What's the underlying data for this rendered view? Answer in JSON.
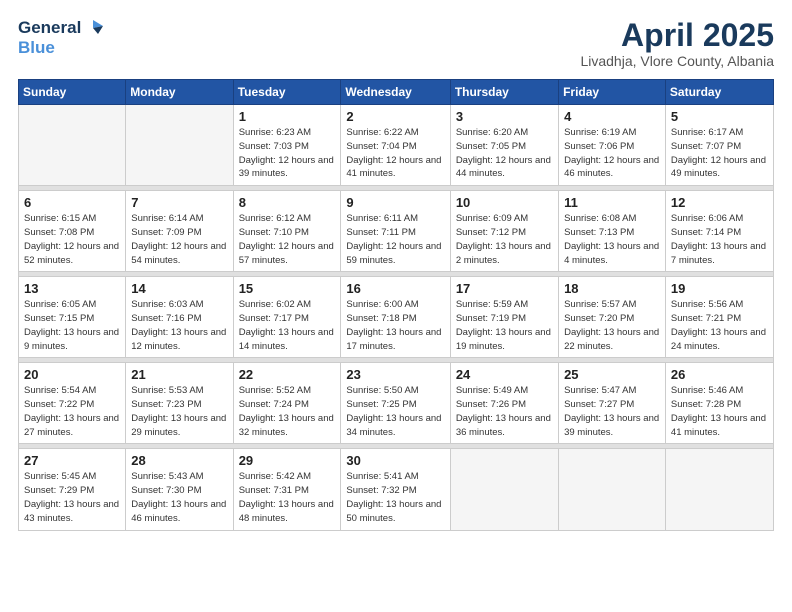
{
  "header": {
    "logo_line1": "General",
    "logo_line2": "Blue",
    "month": "April 2025",
    "location": "Livadhja, Vlore County, Albania"
  },
  "weekdays": [
    "Sunday",
    "Monday",
    "Tuesday",
    "Wednesday",
    "Thursday",
    "Friday",
    "Saturday"
  ],
  "weeks": [
    [
      {
        "day": "",
        "info": ""
      },
      {
        "day": "",
        "info": ""
      },
      {
        "day": "1",
        "info": "Sunrise: 6:23 AM\nSunset: 7:03 PM\nDaylight: 12 hours and 39 minutes."
      },
      {
        "day": "2",
        "info": "Sunrise: 6:22 AM\nSunset: 7:04 PM\nDaylight: 12 hours and 41 minutes."
      },
      {
        "day": "3",
        "info": "Sunrise: 6:20 AM\nSunset: 7:05 PM\nDaylight: 12 hours and 44 minutes."
      },
      {
        "day": "4",
        "info": "Sunrise: 6:19 AM\nSunset: 7:06 PM\nDaylight: 12 hours and 46 minutes."
      },
      {
        "day": "5",
        "info": "Sunrise: 6:17 AM\nSunset: 7:07 PM\nDaylight: 12 hours and 49 minutes."
      }
    ],
    [
      {
        "day": "6",
        "info": "Sunrise: 6:15 AM\nSunset: 7:08 PM\nDaylight: 12 hours and 52 minutes."
      },
      {
        "day": "7",
        "info": "Sunrise: 6:14 AM\nSunset: 7:09 PM\nDaylight: 12 hours and 54 minutes."
      },
      {
        "day": "8",
        "info": "Sunrise: 6:12 AM\nSunset: 7:10 PM\nDaylight: 12 hours and 57 minutes."
      },
      {
        "day": "9",
        "info": "Sunrise: 6:11 AM\nSunset: 7:11 PM\nDaylight: 12 hours and 59 minutes."
      },
      {
        "day": "10",
        "info": "Sunrise: 6:09 AM\nSunset: 7:12 PM\nDaylight: 13 hours and 2 minutes."
      },
      {
        "day": "11",
        "info": "Sunrise: 6:08 AM\nSunset: 7:13 PM\nDaylight: 13 hours and 4 minutes."
      },
      {
        "day": "12",
        "info": "Sunrise: 6:06 AM\nSunset: 7:14 PM\nDaylight: 13 hours and 7 minutes."
      }
    ],
    [
      {
        "day": "13",
        "info": "Sunrise: 6:05 AM\nSunset: 7:15 PM\nDaylight: 13 hours and 9 minutes."
      },
      {
        "day": "14",
        "info": "Sunrise: 6:03 AM\nSunset: 7:16 PM\nDaylight: 13 hours and 12 minutes."
      },
      {
        "day": "15",
        "info": "Sunrise: 6:02 AM\nSunset: 7:17 PM\nDaylight: 13 hours and 14 minutes."
      },
      {
        "day": "16",
        "info": "Sunrise: 6:00 AM\nSunset: 7:18 PM\nDaylight: 13 hours and 17 minutes."
      },
      {
        "day": "17",
        "info": "Sunrise: 5:59 AM\nSunset: 7:19 PM\nDaylight: 13 hours and 19 minutes."
      },
      {
        "day": "18",
        "info": "Sunrise: 5:57 AM\nSunset: 7:20 PM\nDaylight: 13 hours and 22 minutes."
      },
      {
        "day": "19",
        "info": "Sunrise: 5:56 AM\nSunset: 7:21 PM\nDaylight: 13 hours and 24 minutes."
      }
    ],
    [
      {
        "day": "20",
        "info": "Sunrise: 5:54 AM\nSunset: 7:22 PM\nDaylight: 13 hours and 27 minutes."
      },
      {
        "day": "21",
        "info": "Sunrise: 5:53 AM\nSunset: 7:23 PM\nDaylight: 13 hours and 29 minutes."
      },
      {
        "day": "22",
        "info": "Sunrise: 5:52 AM\nSunset: 7:24 PM\nDaylight: 13 hours and 32 minutes."
      },
      {
        "day": "23",
        "info": "Sunrise: 5:50 AM\nSunset: 7:25 PM\nDaylight: 13 hours and 34 minutes."
      },
      {
        "day": "24",
        "info": "Sunrise: 5:49 AM\nSunset: 7:26 PM\nDaylight: 13 hours and 36 minutes."
      },
      {
        "day": "25",
        "info": "Sunrise: 5:47 AM\nSunset: 7:27 PM\nDaylight: 13 hours and 39 minutes."
      },
      {
        "day": "26",
        "info": "Sunrise: 5:46 AM\nSunset: 7:28 PM\nDaylight: 13 hours and 41 minutes."
      }
    ],
    [
      {
        "day": "27",
        "info": "Sunrise: 5:45 AM\nSunset: 7:29 PM\nDaylight: 13 hours and 43 minutes."
      },
      {
        "day": "28",
        "info": "Sunrise: 5:43 AM\nSunset: 7:30 PM\nDaylight: 13 hours and 46 minutes."
      },
      {
        "day": "29",
        "info": "Sunrise: 5:42 AM\nSunset: 7:31 PM\nDaylight: 13 hours and 48 minutes."
      },
      {
        "day": "30",
        "info": "Sunrise: 5:41 AM\nSunset: 7:32 PM\nDaylight: 13 hours and 50 minutes."
      },
      {
        "day": "",
        "info": ""
      },
      {
        "day": "",
        "info": ""
      },
      {
        "day": "",
        "info": ""
      }
    ]
  ]
}
